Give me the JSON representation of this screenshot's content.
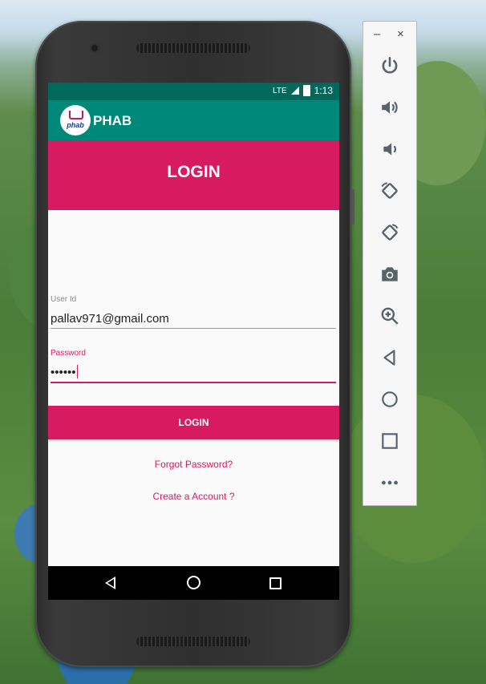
{
  "status_bar": {
    "network": "LTE",
    "time": "1:13"
  },
  "app_bar": {
    "logo_text": "phab",
    "app_name": "PHAB"
  },
  "banner": {
    "title": "LOGIN"
  },
  "form": {
    "user_id": {
      "label": "User Id",
      "value": "pallav971@gmail.com"
    },
    "password": {
      "label": "Password",
      "value": "••••••"
    },
    "login_button": "LOGIN",
    "forgot_password": "Forgot Password?",
    "create_account": "Create a Account ?"
  },
  "colors": {
    "status_bar": "#00695c",
    "app_bar": "#00897b",
    "accent": "#d81b60",
    "screen_bg": "#fafafa"
  },
  "emulator_toolbar": {
    "buttons": [
      "power-icon",
      "volume-up-icon",
      "volume-down-icon",
      "rotate-left-icon",
      "rotate-right-icon",
      "camera-icon",
      "zoom-icon",
      "back-icon",
      "home-icon",
      "overview-icon",
      "more-icon"
    ]
  }
}
